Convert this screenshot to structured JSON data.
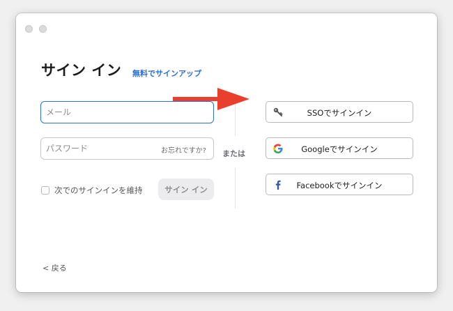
{
  "window": {
    "title": "サイン イン",
    "signup_link": "無料でサインアップ"
  },
  "form": {
    "email_placeholder": "メール",
    "password_placeholder": "パスワード",
    "forgot_label": "お忘れですか?",
    "keep_signed_in_label": "次でのサインインを維持",
    "keep_signed_in_checked": false,
    "signin_button": "サイン イン"
  },
  "divider": {
    "or_label": "または"
  },
  "providers": [
    {
      "label": "SSOでサインイン",
      "icon": "key-icon"
    },
    {
      "label": "Googleでサインイン",
      "icon": "google-icon"
    },
    {
      "label": "Facebookでサインイン",
      "icon": "facebook-icon"
    }
  ],
  "footer": {
    "back_label": "戻る"
  },
  "colors": {
    "accent": "#2d6fd6",
    "annotation_arrow": "#e8402c"
  }
}
